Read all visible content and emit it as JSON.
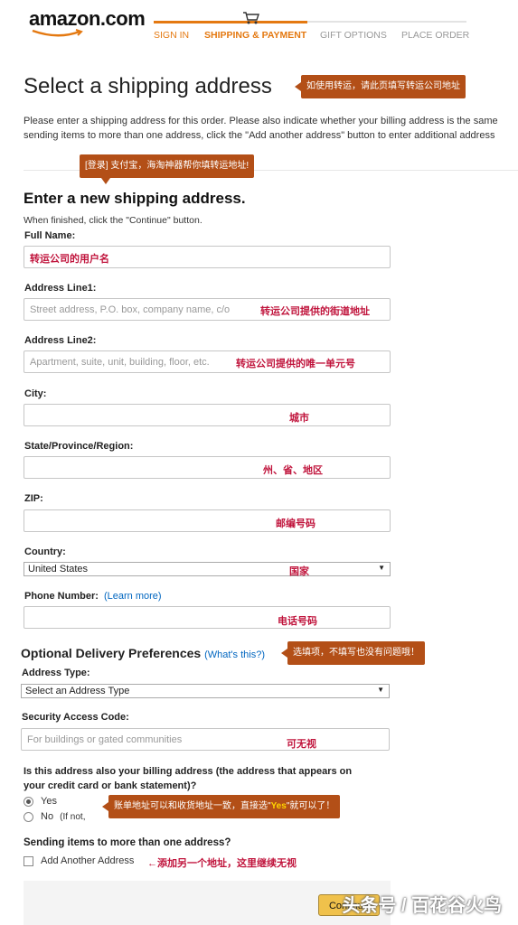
{
  "header": {
    "logo_text": "amazon.com",
    "steps": [
      "SIGN IN",
      "SHIPPING & PAYMENT",
      "GIFT OPTIONS",
      "PLACE ORDER"
    ]
  },
  "page_title": "Select a shipping address",
  "notes": {
    "title_note": "如使用转运，请此页填写转运公司地址",
    "login_note": "[登录] 支付宝，海淘神器帮你填转运地址!",
    "optional_note": "选填项，不填写也没有问题哦！",
    "billing_note_prefix": "账单地址可以和收货地址一致，直接选\"",
    "billing_note_yes": "Yes",
    "billing_note_suffix": "\"就可以了！"
  },
  "intro_lines": [
    "Please enter a shipping address for this order. Please also indicate whether your billing address is the same",
    "sending items to more than one address, click the \"Add another address\" button to enter additional address"
  ],
  "form": {
    "heading": "Enter a new shipping address.",
    "hint": "When finished, click the \"Continue\" button.",
    "full_name": {
      "label": "Full Name:",
      "annotation": "转运公司的用户名"
    },
    "address1": {
      "label": "Address Line1:",
      "placeholder": "Street address, P.O. box, company name, c/o",
      "annotation": "转运公司提供的街道地址"
    },
    "address2": {
      "label": "Address Line2:",
      "placeholder": "Apartment, suite, unit, building, floor, etc.",
      "annotation": "转运公司提供的唯一单元号"
    },
    "city": {
      "label": "City:",
      "annotation": "城市"
    },
    "state": {
      "label": "State/Province/Region:",
      "annotation": "州、省、地区"
    },
    "zip": {
      "label": "ZIP:",
      "annotation": "邮编号码"
    },
    "country": {
      "label": "Country:",
      "value": "United States",
      "annotation": "国家"
    },
    "phone": {
      "label": "Phone Number:",
      "link": "(Learn more)",
      "annotation": "电话号码"
    }
  },
  "optional": {
    "heading": "Optional Delivery Preferences",
    "link": "(What's this?)",
    "address_type": {
      "label": "Address Type:",
      "value": "Select an Address Type"
    },
    "security": {
      "label": "Security Access Code:",
      "placeholder": "For buildings or gated communities",
      "annotation": "可无视"
    }
  },
  "billing": {
    "question_line1": "Is this address also your billing address (the address that appears on",
    "question_line2": "your credit card or bank statement)?",
    "yes": "Yes",
    "no": "No",
    "no_hint": "(If not, ",
    "selected": "Yes"
  },
  "multiple": {
    "question": "Sending items to more than one address?",
    "checkbox_label": "Add Another Address",
    "annotation": "←添加另一个地址，这里继续无视"
  },
  "continue_label": "Continue",
  "watermark": "头条号 / 百花谷火鸟",
  "colors": {
    "accent": "#e47911",
    "note_bg": "#b34f17",
    "annotation_red": "#c0143c",
    "link": "#0066c0"
  }
}
